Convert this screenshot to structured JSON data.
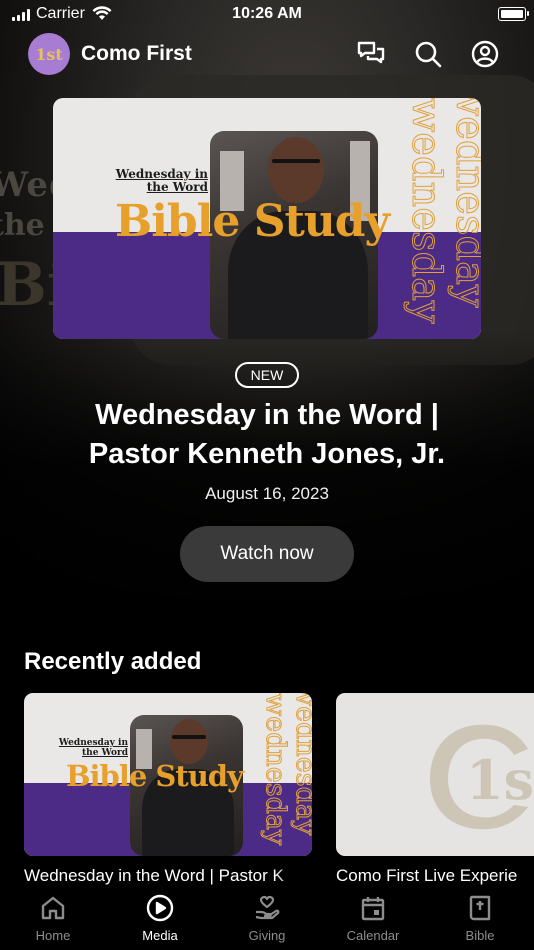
{
  "status_bar": {
    "carrier": "Carrier",
    "time": "10:26 AM"
  },
  "header": {
    "app_title": "Como First",
    "logo_text": "1st"
  },
  "hero": {
    "card": {
      "small_title_line1": "Wednesday in",
      "small_title_line2": "the Word",
      "big_title": "Bible Study",
      "vertical_word": "wednesday"
    },
    "badge": "NEW",
    "title_line1": "Wednesday in the Word |",
    "title_line2": "Pastor Kenneth Jones, Jr.",
    "date": "August 16, 2023",
    "watch_label": "Watch now"
  },
  "recent": {
    "title": "Recently added",
    "items": [
      {
        "caption": "Wednesday in the Word | Pastor K",
        "small_title_line1": "Wednesday in",
        "small_title_line2": "the Word",
        "big_title": "Bible Study",
        "vertical_word": "wednesday"
      },
      {
        "caption": "Como First Live Experie",
        "logo_text": "1st"
      }
    ]
  },
  "tabs": [
    {
      "label": "Home",
      "icon": "home-icon",
      "active": false
    },
    {
      "label": "Media",
      "icon": "play-circle-icon",
      "active": true
    },
    {
      "label": "Giving",
      "icon": "giving-hand-icon",
      "active": false
    },
    {
      "label": "Calendar",
      "icon": "calendar-icon",
      "active": false
    },
    {
      "label": "Bible",
      "icon": "bible-icon",
      "active": false
    }
  ],
  "colors": {
    "accent_purple": "#4b2b86",
    "gold": "#e6a02b",
    "logo_bg": "#a77cd3",
    "button_bg": "#3a3a3a"
  }
}
